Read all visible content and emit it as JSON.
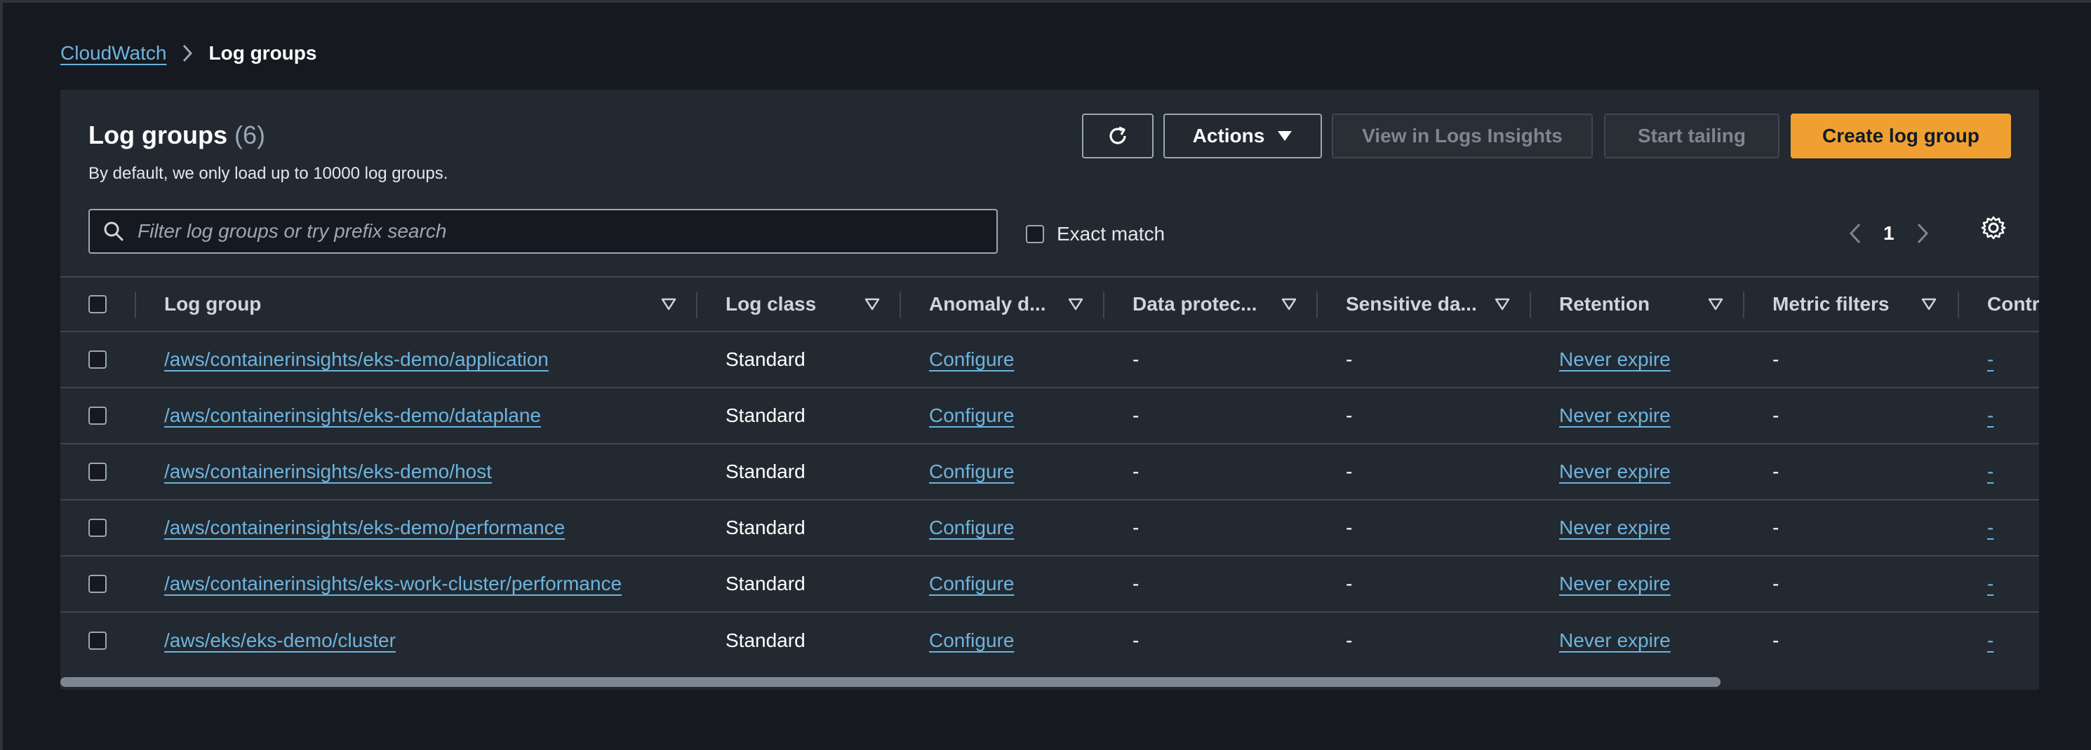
{
  "breadcrumb": {
    "root": "CloudWatch",
    "current": "Log groups"
  },
  "header": {
    "title": "Log groups",
    "count": "(6)",
    "subtitle": "By default, we only load up to 10000 log groups.",
    "actions_label": "Actions",
    "view_insights_label": "View in Logs Insights",
    "start_tailing_label": "Start tailing",
    "create_label": "Create log group"
  },
  "search": {
    "placeholder": "Filter log groups or try prefix search",
    "value": ""
  },
  "exact_match": {
    "label": "Exact match",
    "checked": false
  },
  "pagination": {
    "current_page": "1"
  },
  "table": {
    "columns": [
      "Log group",
      "Log class",
      "Anomaly d...",
      "Data protec...",
      "Sensitive da...",
      "Retention",
      "Metric filters",
      "Contr"
    ],
    "rows": [
      {
        "log_group": "/aws/containerinsights/eks-demo/application",
        "log_class": "Standard",
        "anomaly": "Configure",
        "data_protection": "-",
        "sensitive": "-",
        "retention": "Never expire",
        "metric_filters": "-",
        "contributor": "-"
      },
      {
        "log_group": "/aws/containerinsights/eks-demo/dataplane",
        "log_class": "Standard",
        "anomaly": "Configure",
        "data_protection": "-",
        "sensitive": "-",
        "retention": "Never expire",
        "metric_filters": "-",
        "contributor": "-"
      },
      {
        "log_group": "/aws/containerinsights/eks-demo/host",
        "log_class": "Standard",
        "anomaly": "Configure",
        "data_protection": "-",
        "sensitive": "-",
        "retention": "Never expire",
        "metric_filters": "-",
        "contributor": "-"
      },
      {
        "log_group": "/aws/containerinsights/eks-demo/performance",
        "log_class": "Standard",
        "anomaly": "Configure",
        "data_protection": "-",
        "sensitive": "-",
        "retention": "Never expire",
        "metric_filters": "-",
        "contributor": "-"
      },
      {
        "log_group": "/aws/containerinsights/eks-work-cluster/performance",
        "log_class": "Standard",
        "anomaly": "Configure",
        "data_protection": "-",
        "sensitive": "-",
        "retention": "Never expire",
        "metric_filters": "-",
        "contributor": "-"
      },
      {
        "log_group": "/aws/eks/eks-demo/cluster",
        "log_class": "Standard",
        "anomaly": "Configure",
        "data_protection": "-",
        "sensitive": "-",
        "retention": "Never expire",
        "metric_filters": "-",
        "contributor": "-"
      }
    ]
  },
  "icons": {
    "refresh": "refresh-icon",
    "dropdown": "caret-down-icon",
    "search": "search-icon",
    "prev": "chevron-left-icon",
    "next": "chevron-right-icon",
    "settings": "gear-icon",
    "sort": "sort-triangle-icon"
  },
  "colors": {
    "background": "#16191f",
    "panel": "#232930",
    "link": "#6cb4e0",
    "primary_button": "#f0a030"
  }
}
